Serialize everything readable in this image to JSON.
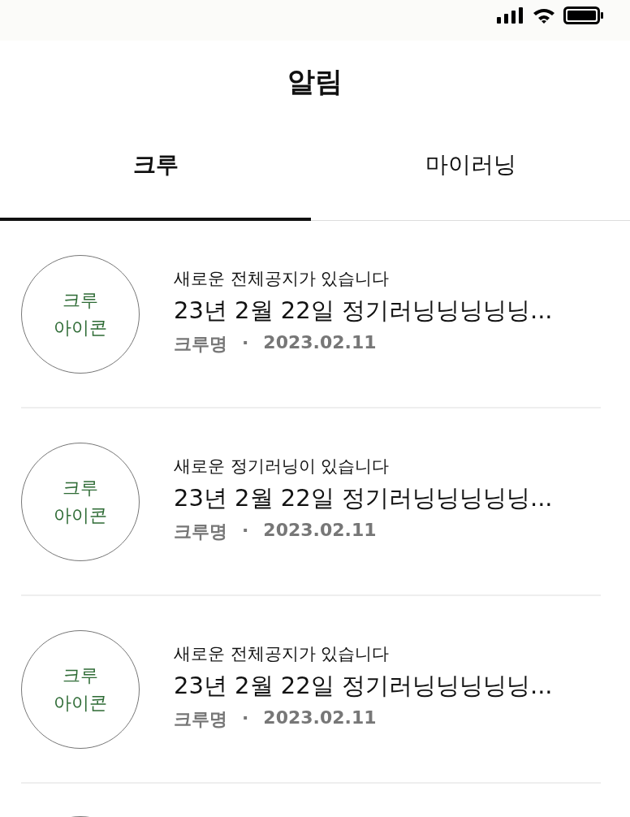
{
  "header": {
    "title": "알림"
  },
  "tabs": [
    {
      "label": "크루",
      "selected": true
    },
    {
      "label": "마이러닝",
      "selected": false
    }
  ],
  "notifications": [
    {
      "avatar": [
        "크루",
        "아이콘"
      ],
      "message": "새로운 전체공지가 있습니다",
      "title": "23년 2월 22일 정기러닝닝닝닝닝...",
      "crew": "크루명",
      "separator": "·",
      "date": "2023.02.11"
    },
    {
      "avatar": [
        "크루",
        "아이콘"
      ],
      "message": "새로운 정기러닝이 있습니다",
      "title": "23년 2월 22일 정기러닝닝닝닝닝...",
      "crew": "크루명",
      "separator": "·",
      "date": "2023.02.11"
    },
    {
      "avatar": [
        "크루",
        "아이콘"
      ],
      "message": "새로운 전체공지가 있습니다",
      "title": "23년 2월 22일 정기러닝닝닝닝닝...",
      "crew": "크루명",
      "separator": "·",
      "date": "2023.02.11"
    }
  ]
}
